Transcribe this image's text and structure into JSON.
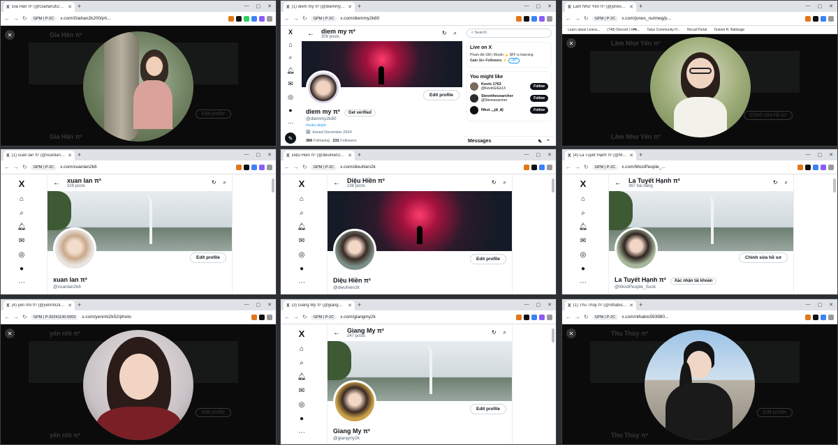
{
  "windows": [
    {
      "tab": "Gia Hân π² (@Giahan2k200) / X",
      "url": "x.com/Giahan2k200/ph...",
      "profile": "GPM | P-2C",
      "ghost_name": "Gia Hân π²",
      "ghost_edit": "Edit profile",
      "mode": "viewer"
    },
    {
      "tab": "(1) diem my π² (@diemmy2k80) / X",
      "url": "x.com/diemmy2k80",
      "profile": "GPM | P-2C",
      "name": "diem my π²",
      "posts": "309 posts",
      "handle": "@diemmy2k80",
      "verify": "Get verified",
      "edit": "Edit profile",
      "tag": "#solix.depin",
      "joined": "Joined December 2024",
      "following": "366",
      "following_label": "Following",
      "followers": "231",
      "followers_label": "Followers",
      "search": "Search",
      "live_title": "Live on X",
      "live_line": "Pham 🎟 SM | Morph 🍌 $FF is listening",
      "live_line2": "Gain 1k+ Followers ⚡",
      "live_more": "+87",
      "might_like": "You might like",
      "suggestions": [
        {
          "name": "Kevin 1763",
          "handle": "@KevinGiGo13"
        },
        {
          "name": "Stevethesearcher",
          "handle": "@Stevesearcher"
        },
        {
          "name": "Nhut ,,,(ఠ_ఠ)",
          "handle": ""
        }
      ],
      "follow": "Follow",
      "messages": "Messages"
    },
    {
      "tab": "Lâm Như Yến π² (@jones_nutmeg/p...",
      "url": "x.com/jones_nutmeg/p...",
      "profile": "GPM | P-2C",
      "bookmarks": [
        "Learn about Linera...",
        "(748) Discord | #🎮...",
        "Talus Community H...",
        "Recall Portal",
        "Testnet R. Babbage"
      ],
      "ghost_name": "Lâm Như Yến π²",
      "ghost_edit": "Chỉnh sửa hồ sơ",
      "mode": "viewer"
    },
    {
      "tab": "(1) xuan lan π² (@xuanlan2k6) / X",
      "url": "x.com/xuanlan2k6",
      "profile": "GPM | P-2C",
      "name": "xuan lan π²",
      "posts": "329 posts",
      "handle": "@xuanlan2k6",
      "edit": "Edit profile"
    },
    {
      "tab": "Diệu Hiền π² (@dieuhien2k) / X",
      "url": "x.com/dieuhien2k",
      "profile": "GPM | P-2C",
      "name": "Diệu Hiền π²",
      "posts": "238 posts",
      "handle": "@dieuhien2k",
      "edit": "Edit profile"
    },
    {
      "tab": "(4) La Tuyết Hạnh π² (@MostP...",
      "url": "x.com/MostPeople_...",
      "profile": "GPM | P-2C",
      "name": "La Tuyết Hạnh π²",
      "posts": "367 bài đăng",
      "handle": "@MostPeople_Suck",
      "verify": "Xác nhận tài khoản",
      "edit": "Chỉnh sửa hồ sơ"
    },
    {
      "tab": "(4) yến nhi π² (@yennhi2k52/p...",
      "url": "x.com/yennhi2k52/photo",
      "profile": "GPM | P-20241130-0003",
      "ghost_name": "yến nhi π²",
      "ghost_edit": "Edit profile",
      "mode": "viewer"
    },
    {
      "tab": "(3) Giang My π² (@giangmy2k) / X",
      "url": "x.com/giangmy2k",
      "profile": "GPM | P-2C",
      "name": "Giang My π²",
      "posts": "247 posts",
      "handle": "@giangmy2k",
      "edit": "Edit profile"
    },
    {
      "tab": "(1) Thu Thủy π² (@nthabis5939...",
      "url": "x.com/nthabis593980...",
      "profile": "GPM | P-2C",
      "ghost_name": "Thu Thủy π²",
      "ghost_edit": "Edit profile",
      "mode": "viewer"
    }
  ],
  "icons": {
    "close": "✕",
    "back": "←",
    "refresh": "↻",
    "search": "⌕",
    "x_logo": "𝕏"
  }
}
